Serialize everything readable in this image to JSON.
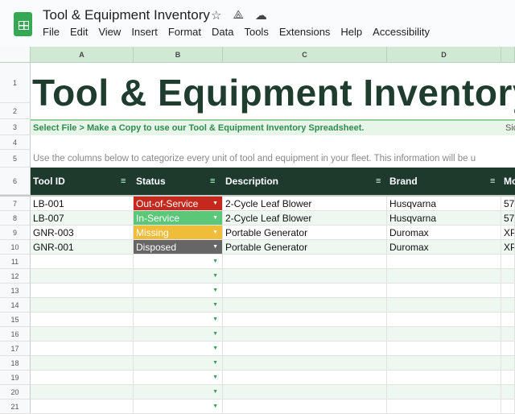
{
  "app": {
    "title": "Tool & Equipment Inventory",
    "icons": [
      "star-icon",
      "move-to-drive-icon",
      "cloud-status-icon"
    ],
    "menu": [
      "File",
      "Edit",
      "View",
      "Insert",
      "Format",
      "Data",
      "Tools",
      "Extensions",
      "Help",
      "Accessibility"
    ]
  },
  "columns": [
    "A",
    "B",
    "C",
    "D"
  ],
  "sheet": {
    "heading": "Tool & Equipment Inventory",
    "instruction": "Select File > Make a Copy to use our Tool & Equipment Inventory Spreadsheet.",
    "instruction_e": "Sid",
    "note": "Use the columns below to categorize every unit of tool and equipment in your fleet. This information will be u",
    "headers": [
      "Tool ID",
      "Status",
      "Description",
      "Brand",
      "Mo"
    ],
    "rows": [
      {
        "id": "LB-001",
        "status": "Out-of-Service",
        "status_color": "#c5281c",
        "description": "2-Cycle Leaf Blower",
        "brand": "Husqvarna",
        "model": "57"
      },
      {
        "id": "LB-007",
        "status": "In-Service",
        "status_color": "#5ac878",
        "description": "2-Cycle Leaf Blower",
        "brand": "Husqvarna",
        "model": "57"
      },
      {
        "id": "GNR-003",
        "status": "Missing",
        "status_color": "#f0bd3a",
        "description": "Portable Generator",
        "brand": "Duromax",
        "model": "XP"
      },
      {
        "id": "GNR-001",
        "status": "Disposed",
        "status_color": "#666666",
        "description": "Portable Generator",
        "brand": "Duromax",
        "model": "XP"
      }
    ]
  },
  "row_numbers": [
    "1",
    "2",
    "3",
    "4",
    "5",
    "6",
    "7",
    "8",
    "9",
    "10",
    "11",
    "12",
    "13",
    "14",
    "15",
    "16",
    "17",
    "18",
    "19",
    "20",
    "21"
  ]
}
